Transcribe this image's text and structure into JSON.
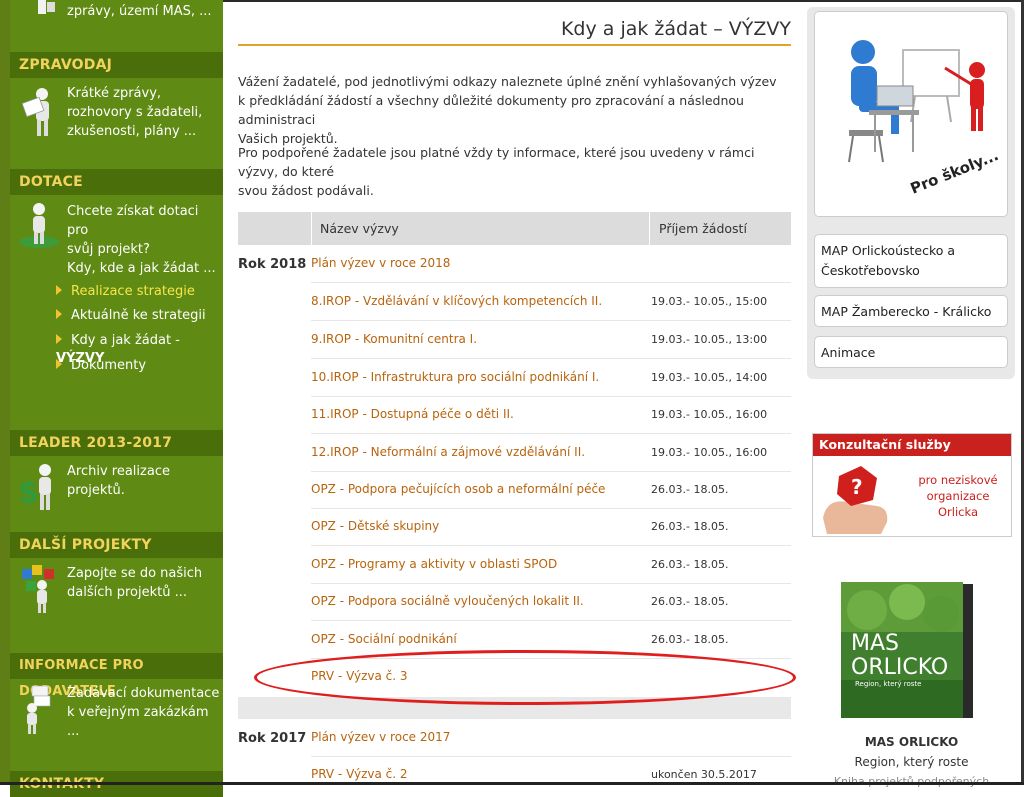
{
  "sidebar": {
    "top_text": "zprávy, území MAS, ...",
    "sections": [
      {
        "heading": "ZPRAVODAJ",
        "lines": [
          "Krátké zprávy,",
          "rozhovory s žadateli,",
          "zkušenosti, plány ..."
        ]
      },
      {
        "heading": "DOTACE",
        "lines": [
          "Chcete získat dotaci pro",
          "svůj projekt?",
          "Kdy, kde a jak žádat ..."
        ]
      },
      {
        "heading": "LEADER 2013-2017",
        "lines": [
          "Archiv realizace projektů."
        ]
      },
      {
        "heading": "DALŠÍ PROJEKTY",
        "lines": [
          "Zapojte se do našich",
          "dalších projektů ..."
        ]
      },
      {
        "heading": "INFORMACE PRO DODAVATELE",
        "lines": [
          "Zadávací dokumentace",
          "k veřejným zakázkám ..."
        ]
      },
      {
        "heading": "KONTAKTY",
        "lines": []
      }
    ],
    "submenu": [
      {
        "label": "Realizace strategie",
        "bold": ""
      },
      {
        "label": "Aktuálně ke strategii",
        "bold": ""
      },
      {
        "label": "Kdy a jak žádat - ",
        "bold": "VÝZVY"
      },
      {
        "label": "Dokumenty",
        "bold": ""
      }
    ]
  },
  "main": {
    "title": "Kdy a jak žádat – VÝZVY",
    "intro": [
      "Vážení žadatelé, pod jednotlivými odkazy naleznete úplné znění vyhlašovaných výzev",
      "k předkládání žádostí a všechny důležité dokumenty pro zpracování a následnou administraci",
      "Vašich projektů."
    ],
    "intro2": [
      "Pro podpořené žadatele jsou platné vždy ty informace, které jsou uvedeny v rámci výzvy, do které",
      "svou žádost podávali."
    ],
    "table_headers": [
      "Název výzvy",
      "Příjem žádostí"
    ],
    "years": [
      {
        "year": "Rok 2018",
        "plan": "Plán výzev v roce 2018",
        "rows": [
          {
            "name": "8.IROP - Vzdělávání v klíčových kompetencích II.",
            "date": "19.03.- 10.05., 15:00"
          },
          {
            "name": "9.IROP - Komunitní centra I.",
            "date": "19.03.- 10.05., 13:00"
          },
          {
            "name": "10.IROP - Infrastruktura pro sociální podnikání I.",
            "date": "19.03.- 10.05., 14:00"
          },
          {
            "name": "11.IROP - Dostupná péče o děti II.",
            "date": "19.03.- 10.05., 16:00"
          },
          {
            "name": "12.IROP - Neformální a zájmové vzdělávání II.",
            "date": "19.03.- 10.05., 16:00"
          },
          {
            "name": "OPZ - Podpora pečujících osob a neformální péče",
            "date": "26.03.- 18.05."
          },
          {
            "name": "OPZ - Dětské skupiny",
            "date": "26.03.- 18.05."
          },
          {
            "name": "OPZ - Programy a aktivity v oblasti SPOD",
            "date": "26.03.- 18.05."
          },
          {
            "name": "OPZ - Podpora sociálně vyloučených lokalit II.",
            "date": "26.03.- 18.05."
          },
          {
            "name": "OPZ - Sociální podnikání",
            "date": "26.03.- 18.05."
          },
          {
            "name": "PRV - Výzva č. 3",
            "date": ""
          }
        ]
      },
      {
        "year": "Rok 2017",
        "plan": "Plán výzev v roce 2017",
        "rows": [
          {
            "name": "PRV - Výzva č. 2",
            "date": "ukončen 30.5.2017"
          }
        ]
      }
    ]
  },
  "right": {
    "school_caption": "Pro školy...",
    "links": [
      "MAP Orlickoústecko a Českotřebovsko",
      "MAP Žamberecko - Králicko",
      "Animace"
    ],
    "consult_title": "Konzultační služby",
    "consult_text": [
      "pro neziskové",
      "organizace",
      "Orlicka"
    ],
    "book_title_lines": [
      "MAS",
      "ORLICKO"
    ],
    "book_subtitle": "Region, který roste",
    "book_caption_1": "MAS ORLICKO",
    "book_caption_2": "Region, který roste",
    "book_caption_3": "Kniha projektů podpořených"
  },
  "colors": {
    "sidebar": "#5f8a14",
    "sidebar_head": "#4a6f0a",
    "heading_text": "#f2d35c",
    "link": "#b8640e",
    "accent_rule": "#e2a326",
    "highlight": "#e01e1e",
    "consult": "#c9211e"
  }
}
